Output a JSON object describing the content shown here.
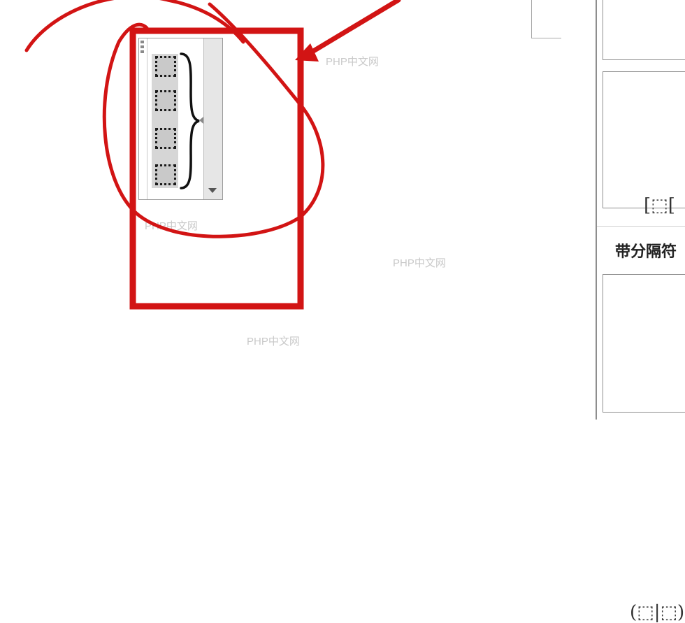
{
  "watermark": "PHP中文网",
  "equation": {
    "type": "matrix-with-brace",
    "slot_count": 4,
    "brace_glyph": "}"
  },
  "panel": {
    "section_title": "带分隔符",
    "templates": [
      {
        "label": "[⬚["
      },
      {
        "label": "(⬚|⬚)"
      }
    ]
  },
  "colors": {
    "annotation_red": "#d21414",
    "slot_fill": "#c9c9c9",
    "watermark": "#c9c9c9"
  },
  "icons": [
    "move-handle-icon",
    "arrow-left-icon",
    "dropdown-arrow-icon"
  ]
}
